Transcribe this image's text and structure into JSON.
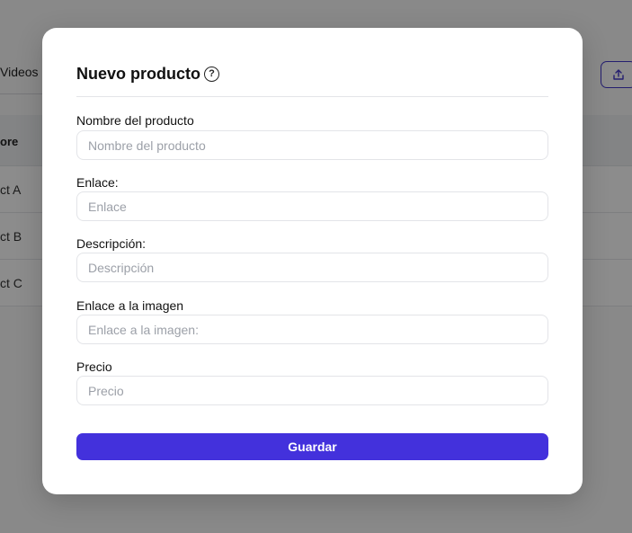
{
  "background": {
    "tab_label": "Videos",
    "column_header": "ore",
    "rows": [
      "ct A",
      "ct B",
      "ct C"
    ],
    "export_icon": "upload-icon"
  },
  "modal": {
    "title": "Nuevo producto",
    "help_icon": "?",
    "fields": [
      {
        "label": "Nombre del producto",
        "placeholder": "Nombre del producto",
        "value": ""
      },
      {
        "label": "Enlace:",
        "placeholder": "Enlace",
        "value": ""
      },
      {
        "label": "Descripción:",
        "placeholder": "Descripción",
        "value": ""
      },
      {
        "label": "Enlace a la imagen",
        "placeholder": "Enlace a la imagen:",
        "value": ""
      },
      {
        "label": "Precio",
        "placeholder": "Precio",
        "value": ""
      }
    ],
    "save_label": "Guardar"
  },
  "colors": {
    "accent": "#4331dc",
    "overlay": "rgba(0,0,0,0.45)"
  }
}
